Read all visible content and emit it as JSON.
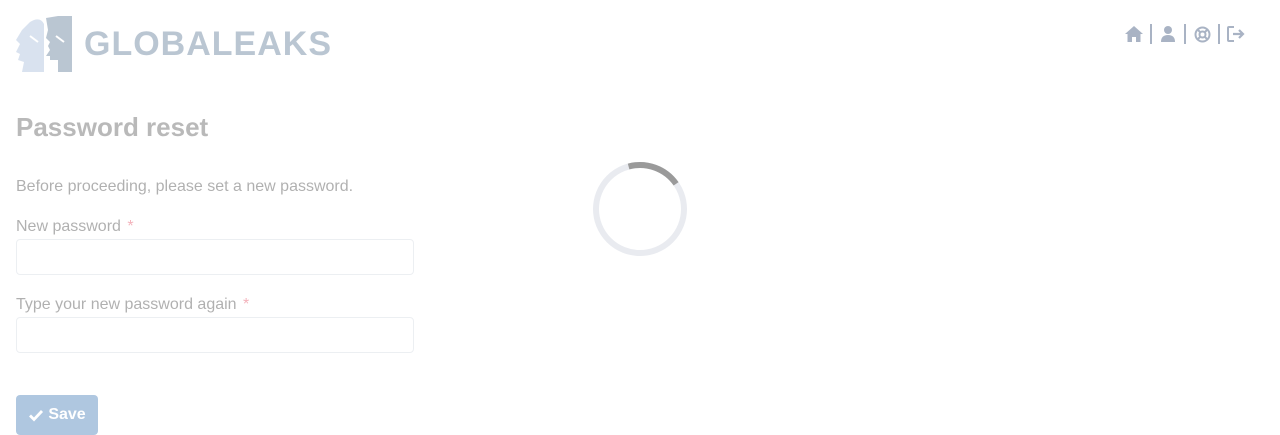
{
  "header": {
    "brand": "GLOBALEAKS",
    "nav": {
      "icons": [
        "home-icon",
        "user-icon",
        "support-icon",
        "logout-icon"
      ]
    }
  },
  "main": {
    "title": "Password reset",
    "intro": "Before proceeding, please set a new password.",
    "fields": {
      "new_password": {
        "label": "New password",
        "required_mark": "*",
        "value": ""
      },
      "confirm_password": {
        "label": "Type your new password again",
        "required_mark": "*",
        "value": ""
      }
    },
    "save_label": "Save"
  },
  "colors": {
    "brand": "#4d6b8c",
    "logo_light": "#9cb5d6",
    "nav_icon": "#1f3b66",
    "required": "#e0344b",
    "primary_button": "#2f6db0",
    "spinner": "#888888"
  },
  "loading": true
}
